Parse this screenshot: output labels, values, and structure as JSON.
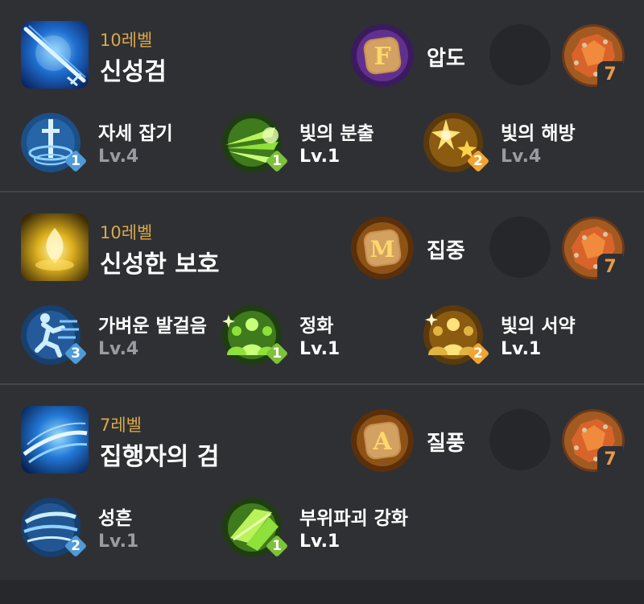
{
  "skills": [
    {
      "level": "10레벨",
      "name": "신성검",
      "rune": {
        "label": "압도",
        "letter": "F",
        "theme": "purple"
      },
      "gem_count": "7",
      "tripods": [
        {
          "name": "자세 잡기",
          "lv": "Lv.4",
          "tier": "1",
          "color": "blue"
        },
        {
          "name": "빛의 분출",
          "lv": "Lv.1",
          "tier": "1",
          "color": "green"
        },
        {
          "name": "빛의 해방",
          "lv": "Lv.4",
          "tier": "2",
          "color": "orange"
        }
      ]
    },
    {
      "level": "10레벨",
      "name": "신성한 보호",
      "rune": {
        "label": "집중",
        "letter": "M",
        "theme": "orange"
      },
      "gem_count": "7",
      "tripods": [
        {
          "name": "가벼운 발걸음",
          "lv": "Lv.4",
          "tier": "3",
          "color": "blue"
        },
        {
          "name": "정화",
          "lv": "Lv.1",
          "tier": "1",
          "color": "green"
        },
        {
          "name": "빛의 서약",
          "lv": "Lv.1",
          "tier": "2",
          "color": "orange"
        }
      ]
    },
    {
      "level": "7레벨",
      "name": "집행자의 검",
      "rune": {
        "label": "질풍",
        "letter": "A",
        "theme": "orange"
      },
      "gem_count": "7",
      "tripods": [
        {
          "name": "성흔",
          "lv": "Lv.1",
          "tier": "2",
          "color": "blue"
        },
        {
          "name": "부위파괴 강화",
          "lv": "Lv.1",
          "tier": "1",
          "color": "green"
        }
      ]
    }
  ],
  "colors": {
    "background": "#2f3034",
    "level_text": "#d9a949",
    "lv_dim": "#9a9ba0",
    "badge_blue": "#4f9bd8",
    "badge_green": "#7dc238",
    "badge_orange": "#f2a431",
    "gem_count": "#e79a4a"
  },
  "icons": {
    "skill_icons": [
      "holy-sword-skill-icon",
      "holy-protection-skill-icon",
      "executioner-sword-skill-icon"
    ],
    "tripod_icons": [
      [
        "stance-sword-icon",
        "light-burst-icon",
        "light-release-icon"
      ],
      [
        "running-figure-icon",
        "purify-group-icon",
        "light-oath-icon"
      ],
      [
        "wind-swirl-icon",
        "green-blade-icon"
      ]
    ],
    "rune": "rune-stone-icon",
    "gem": "gem-icon"
  }
}
